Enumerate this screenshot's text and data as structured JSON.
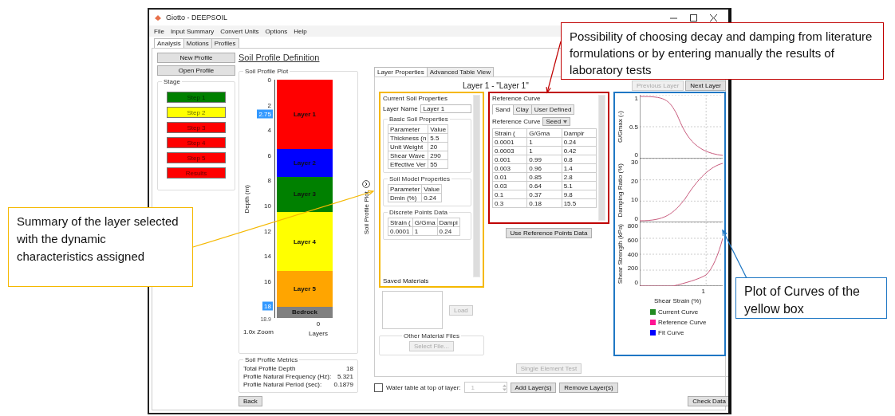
{
  "window": {
    "title": "Giotto - DEEPSOIL"
  },
  "menu": [
    "File",
    "Input Summary",
    "Convert Units",
    "Options",
    "Help"
  ],
  "main_tabs": [
    {
      "label": "Analysis",
      "selected": true
    },
    {
      "label": "Motions",
      "selected": false
    },
    {
      "label": "Profiles",
      "selected": false
    }
  ],
  "sidebar": {
    "buttons": [
      "New Profile",
      "Open Profile"
    ],
    "stage_title": "Stage",
    "steps": [
      {
        "label": "Step 1",
        "color": "#008000"
      },
      {
        "label": "Step 2",
        "color": "#ffff00"
      },
      {
        "label": "Step 3",
        "color": "#ff0000"
      },
      {
        "label": "Step 4",
        "color": "#ff0000"
      },
      {
        "label": "Step 5",
        "color": "#ff0000"
      },
      {
        "label": "Results",
        "color": "#ff0000"
      }
    ]
  },
  "profile": {
    "title": "Soil Profile Definition",
    "plot_title": "Soil Profile Plot",
    "ylabel": "Depth (m)",
    "depth_ticks": [
      "0",
      "2",
      "4",
      "6",
      "8",
      "10",
      "12",
      "14",
      "16"
    ],
    "top_marker": "2.75",
    "bottom_marker": "18",
    "bottom_depth": "18.9",
    "layers": [
      {
        "label": "Layer 1",
        "color": "#ff0000"
      },
      {
        "label": "Layer 2",
        "color": "#0000ff"
      },
      {
        "label": "Layer 3",
        "color": "#008000"
      },
      {
        "label": "Layer 4",
        "color": "#ffff00"
      },
      {
        "label": "Layer 5",
        "color": "#ffa500"
      },
      {
        "label": "Bedrock",
        "color": "#808080"
      }
    ],
    "x_tick": "0",
    "xlabel": "Layers",
    "zoom": "1.0x Zoom",
    "metrics_title": "Soil Profile Metrics",
    "metrics": [
      {
        "label": "Total Profile Depth",
        "value": "18"
      },
      {
        "label": "Profile Natural Frequency (Hz):",
        "value": "5.321"
      },
      {
        "label": "Profile Natural Period (sec):",
        "value": "0.1879"
      }
    ],
    "back": "Back"
  },
  "collapsed_strip": "Soil Profile Plot",
  "layer_panel": {
    "tabs": [
      {
        "label": "Layer Properties",
        "selected": true
      },
      {
        "label": "Advanced Table View",
        "selected": false
      }
    ],
    "heading": "Layer 1 - \"Layer 1\"",
    "nav": [
      {
        "label": "Previous Layer",
        "disabled": true
      },
      {
        "label": "Next Layer",
        "disabled": false
      }
    ],
    "current": {
      "title": "Current Soil Properties",
      "name_label": "Layer Name",
      "name_value": "Layer 1",
      "basic_title": "Basic Soil Properties",
      "basic_columns": [
        "Parameter",
        "Value"
      ],
      "basic_rows": [
        [
          "Thickness (n",
          "5.5"
        ],
        [
          "Unit Weight",
          "20"
        ],
        [
          "Shear Wave",
          "290"
        ],
        [
          "Effective Ver",
          "55"
        ]
      ],
      "model_title": "Soil Model Properties",
      "model_columns": [
        "Parameter",
        "Value"
      ],
      "model_rows": [
        [
          "Dmin (%)",
          "0.24"
        ]
      ],
      "discrete_title": "Discrete Points Data",
      "discrete_columns": [
        "Strain (",
        "G/Gma",
        "Dampi"
      ],
      "discrete_rows": [
        [
          "0.0001",
          "1",
          "0.24"
        ]
      ],
      "saved_title": "Saved Materials"
    },
    "load": {
      "label": "Load",
      "disabled": true
    },
    "other_files": {
      "title": "Other Material Files",
      "button": {
        "label": "Select File...",
        "disabled": true
      }
    },
    "reference": {
      "title": "Reference Curve",
      "tabs": [
        {
          "label": "Sand",
          "selected": true
        },
        {
          "label": "Clay",
          "selected": false
        },
        {
          "label": "User Defined",
          "selected": false
        }
      ],
      "curve_label": "Reference Curve",
      "curve_value": "Seed",
      "columns": [
        "Strain (",
        "G/Gma",
        "Dampir"
      ],
      "rows": [
        [
          "0.0001",
          "1",
          "0.24"
        ],
        [
          "0.0003",
          "1",
          "0.42"
        ],
        [
          "0.001",
          "0.99",
          "0.8"
        ],
        [
          "0.003",
          "0.96",
          "1.4"
        ],
        [
          "0.01",
          "0.85",
          "2.8"
        ],
        [
          "0.03",
          "0.64",
          "5.1"
        ],
        [
          "0.1",
          "0.37",
          "9.8"
        ],
        [
          "0.3",
          "0.18",
          "15.5"
        ]
      ],
      "use_button": "Use Reference Points Data"
    },
    "single_test": {
      "label": "Single Element Test",
      "disabled": true
    },
    "curves": {
      "plots": [
        {
          "ylabel": "G/Gmax (-)",
          "yticks": [
            "1",
            "0.5",
            "0"
          ]
        },
        {
          "ylabel": "Damping Ratio (%)",
          "yticks": [
            "30",
            "20",
            "10",
            "0"
          ]
        },
        {
          "ylabel": "Shear Strength (kPa)",
          "yticks": [
            "800",
            "600",
            "400",
            "200",
            "0"
          ]
        }
      ],
      "x_tick": "1",
      "xlabel": "Shear Strain (%)",
      "legend": [
        {
          "label": "Current Curve",
          "color": "#228b22"
        },
        {
          "label": "Reference Curve",
          "color": "#ff1493"
        },
        {
          "label": "Fit Curve",
          "color": "#0000ff"
        }
      ]
    }
  },
  "water_table": {
    "label": "Water table at top of layer:",
    "checked": false,
    "value": "1",
    "value_disabled": true
  },
  "layer_buttons": [
    "Add Layer(s)",
    "Remove Layer(s)"
  ],
  "check_data": "Check Data",
  "callouts": [
    {
      "text": "Summary of the layer selected with the dynamic characteristics assigned",
      "color": "#f5b800"
    },
    {
      "text": "Possibility of choosing decay and damping from literature formulations or by entering manually the results of laboratory tests",
      "color": "#c00000"
    },
    {
      "text": "Plot of Curves of the yellow box",
      "color": "#1f77c4"
    }
  ]
}
